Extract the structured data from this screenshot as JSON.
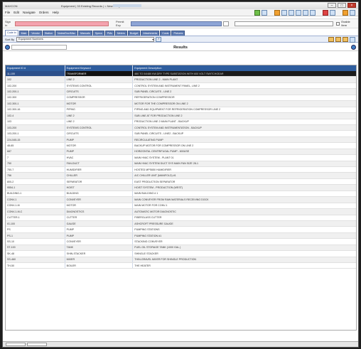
{
  "app": {
    "name": "MAXCON",
    "window_title": "Equipment | 33 Existing Records | < New Entry >"
  },
  "menu": [
    "File",
    "Edit",
    "Navigate",
    "Orders",
    "Help"
  ],
  "entry_bar": {
    "sign_in_label": "Sign In",
    "permit_label": "Permit Exp",
    "checkbox_label": "Enable Item"
  },
  "tabs": [
    {
      "label": "Code In",
      "active": true
    },
    {
      "label": "Main"
    },
    {
      "label": "Vendor"
    },
    {
      "label": "Station"
    },
    {
      "label": "Notes/Doc/Misc"
    },
    {
      "label": "Manuals"
    },
    {
      "label": "Specs"
    },
    {
      "label": "PMs"
    },
    {
      "label": "Meters"
    },
    {
      "label": "Budget"
    },
    {
      "label": "Attachments"
    },
    {
      "label": "Costs"
    },
    {
      "label": "Pictures"
    }
  ],
  "search": {
    "label": "Sort By",
    "selected": "Equipment Numbers"
  },
  "results": {
    "title": "Results"
  },
  "grid": {
    "columns": [
      "Equipment ID #",
      "Equipment Keyword",
      "Equipment Description"
    ],
    "rows": [
      [
        "11-100",
        "TRANSFORMER",
        "480 TO 04/480 KW.DRY TYPE SUBSTATION WITH 600 VOLT SWITCHGEAR"
      ],
      [
        "102",
        "LINE 2",
        "PRODUCTION LINE 2 - MAIN PLANT"
      ],
      [
        "102-200",
        "SYSTEMS CONTROL",
        "CONTROL SYSTEM AND INSTRUMENT PANEL, LINE 2"
      ],
      [
        "102-200-1",
        "CIRCUITS",
        "SUB PANEL CIRCUITS - LINE 2"
      ],
      [
        "102-300",
        "COMPRESSOR",
        "REFRIGERATION COMPRESSOR"
      ],
      [
        "102-300-1",
        "MOTOR",
        "MOTOR FOR THE COMPRESSOR ON LINE 2"
      ],
      [
        "102-300-16",
        "PIPING",
        "PIPING AND EQUIPMENT FOR REFRIGERATION COMPRESSOR LINE 2"
      ],
      [
        "102-4",
        "LINE 2",
        "SUB LINE AT FOR PRODUCTION LINE 2"
      ],
      [
        "103",
        "LINE 2",
        "PRODUCTION LINE 2 MAIN PLANT - BACKUP"
      ],
      [
        "103-200",
        "SYSTEMS CONTROL",
        "CONTROL SYSTEM AND INSTRUMENTATION - BACKUP"
      ],
      [
        "103-200-1",
        "CIRCUITS",
        "SUB PANEL CIRCUITS - LINE2 - BACKUP"
      ],
      [
        "224-545-15",
        "PUMP",
        "RECIRCULATING PUMP"
      ],
      [
        "48-65",
        "MOTOR",
        "BACKUP MOTOR FOR COMPRESSOR ON LINE 2"
      ],
      [
        "687",
        "PUMP",
        "HORIZONTAL CENTRIFUGAL PUMP - 600USE"
      ],
      [
        "7",
        "HVAC",
        "MAIN HVAC SYSTEM - PLANT 01"
      ],
      [
        "750",
        "FAN-DUCT",
        "MAIN HVAC SYSTEM DUCT SYS MAIN FAN SIZE 28-1"
      ],
      [
        "750-7",
        "HUMIDIFIER",
        "HOSTED MPS650 HUMIDIFIER"
      ],
      [
        "756",
        "CHILLER",
        "A/C CHILLER UNIT (MANIFOLD) #1"
      ],
      [
        "800-2",
        "SEPARATOR",
        "EAST PRODUCTION SEPARATOR"
      ],
      [
        "9554-1",
        "HOIST",
        "HOIST SYSTEM - PRODUCTION (WEST)"
      ],
      [
        "BUILDING-1",
        "BUILDING",
        "MAIN BUILDING # 1"
      ],
      [
        "CONV-1",
        "CONVEYER",
        "MAIN CONVEYER FROM RAW MATERIALS RECEIVING DOCK"
      ],
      [
        "CONV-1-M",
        "MOTOR",
        "MAIN MOTOR FOR CONV-1"
      ],
      [
        "CONV-1-M-C",
        "DIAGNOSTICS",
        "AUTOMATIC MOTOR DIAGNOSTIC"
      ],
      [
        "CUTTER-1",
        "CUTTER",
        "FIBERGLASS CUTTER"
      ],
      [
        "IG-100",
        "GAUGE",
        "ASHCROFT PRESSURE GAUGE"
      ],
      [
        "PS",
        "PUMP",
        "PUMPING STATIONS"
      ],
      [
        "PS-1",
        "PUMP",
        "PUMPING STATION #1"
      ],
      [
        "SS-10",
        "CONVEYER",
        "STACKING CONVEYER"
      ],
      [
        "ST-100",
        "TANK",
        "FUEL OIL STORAGE TANK (1000 GAL.)"
      ],
      [
        "SK-48",
        "SHIN-STACKER",
        "SHINGLE STACKER"
      ],
      [
        "SS-460",
        "MIXER",
        "THIN-GRAVEL MIXER FOR SHINGLE PRODUCTION"
      ],
      [
        "TH-50",
        "BOILER",
        "THE HEATER"
      ]
    ]
  }
}
